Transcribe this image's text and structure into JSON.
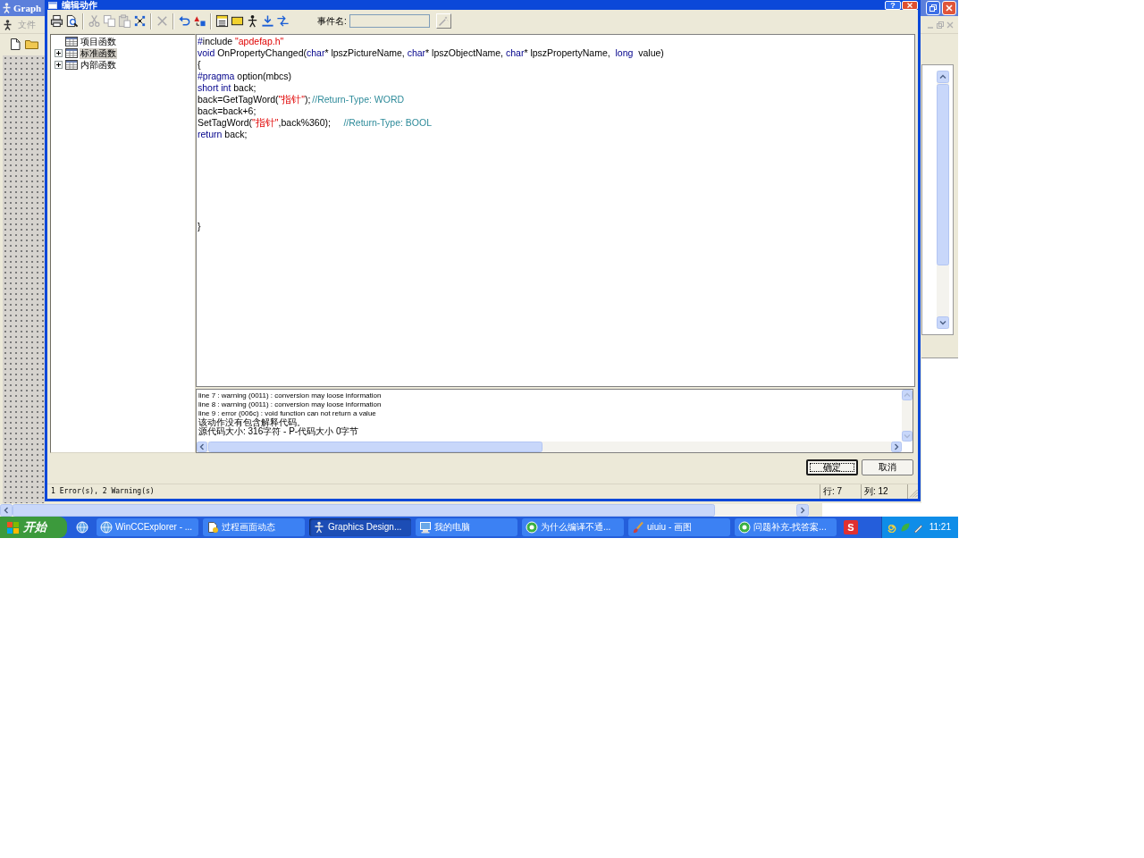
{
  "background_window": {
    "title": "Graph",
    "menu": [
      "文件"
    ]
  },
  "dialog": {
    "title": "编辑动作",
    "help_button": "?",
    "toolbar": {
      "groups": [
        [
          {
            "disabled": false
          },
          {
            "disabled": false
          }
        ],
        [
          {
            "disabled": true
          },
          {
            "disabled": true
          },
          {
            "disabled": true
          },
          {
            "disabled": false
          }
        ],
        [
          {
            "disabled": true
          }
        ],
        [
          {
            "disabled": false
          },
          {
            "disabled": false
          }
        ],
        [
          {
            "disabled": false
          },
          {
            "disabled": false
          },
          {
            "disabled": false
          },
          {
            "disabled": false
          },
          {
            "disabled": false
          }
        ]
      ]
    },
    "event_name": {
      "label": "事件名:",
      "disabled": true
    },
    "event_button": {
      "disabled": true
    },
    "tree": [
      {
        "label": "项目函数",
        "expandable": false,
        "selected": false
      },
      {
        "label": "标准函数",
        "expandable": true,
        "expanded": false,
        "selected": true
      },
      {
        "label": "内部函数",
        "expandable": true,
        "expanded": false,
        "selected": false
      }
    ],
    "editor": {
      "lines": [
        {
          "segments": [
            {
              "kind": "keyword",
              "text": "#"
            },
            {
              "kind": "plain",
              "text": "include "
            },
            {
              "kind": "string",
              "text": "\"apdefap.h\""
            }
          ]
        },
        {
          "segments": [
            {
              "kind": "keyword",
              "text": "void"
            },
            {
              "kind": "plain",
              "text": " OnPropertyChanged("
            },
            {
              "kind": "keyword",
              "text": "char"
            },
            {
              "kind": "plain",
              "text": "* lpszPictureName, "
            },
            {
              "kind": "keyword",
              "text": "char"
            },
            {
              "kind": "plain",
              "text": "* lpszObjectName, "
            },
            {
              "kind": "keyword",
              "text": "char"
            },
            {
              "kind": "plain",
              "text": "* lpszPropertyName,  "
            },
            {
              "kind": "keyword",
              "text": "long"
            },
            {
              "kind": "plain",
              "text": "  value)"
            }
          ]
        },
        {
          "segments": [
            {
              "kind": "plain",
              "text": "{"
            }
          ]
        },
        {
          "segments": [
            {
              "kind": "keyword",
              "text": "#pragma"
            },
            {
              "kind": "plain",
              "text": " option(mbcs)"
            }
          ]
        },
        {
          "segments": [
            {
              "kind": "keyword",
              "text": "short int"
            },
            {
              "kind": "plain",
              "text": " back;"
            }
          ]
        },
        {
          "segments": [
            {
              "kind": "plain",
              "text": "back=GetTagWord("
            },
            {
              "kind": "string",
              "text": "\"指针\""
            },
            {
              "kind": "plain",
              "text": ");\t"
            },
            {
              "kind": "comment",
              "text": "//Return-Type: WORD"
            }
          ]
        },
        {
          "segments": [
            {
              "kind": "plain",
              "text": "back=back+6;"
            }
          ]
        },
        {
          "segments": [
            {
              "kind": "plain",
              "text": "SetTagWord("
            },
            {
              "kind": "string",
              "text": "\"指针\""
            },
            {
              "kind": "plain",
              "text": ",back%360);\t\t"
            },
            {
              "kind": "comment",
              "text": "//Return-Type: BOOL"
            }
          ]
        },
        {
          "segments": [
            {
              "kind": "keyword",
              "text": "return"
            },
            {
              "kind": "plain",
              "text": " back;"
            }
          ]
        }
      ],
      "closing_line": "}"
    },
    "output": {
      "lines": [
        {
          "kind": "diagnostic",
          "text": "line 7 : warning (0011) : conversion may loose information"
        },
        {
          "kind": "diagnostic",
          "text": "line 8 : warning (0011) : conversion may loose information"
        },
        {
          "kind": "diagnostic",
          "text": "line 9 : error (006c) : void function can not return a value"
        },
        {
          "kind": "summary",
          "text": "该动作没有包含解释代码。"
        },
        {
          "kind": "summary",
          "text": "源代码大小: 316字符 - P-代码大小 0字节"
        }
      ]
    },
    "buttons": [
      {
        "label": "确定",
        "focused": true
      },
      {
        "label": "取消",
        "focused": false
      }
    ],
    "status_bar": {
      "message": "1 Error(s), 2 Warning(s)",
      "row": "行: 7",
      "column": "列: 12"
    }
  },
  "taskbar": {
    "start": "开始",
    "tasks": [
      {
        "label": "WinCCExplorer - ...",
        "selected": false
      },
      {
        "label": "过程画面动态",
        "selected": false
      },
      {
        "label": "Graphics Design...",
        "selected": true
      },
      {
        "label": "我的电脑",
        "selected": false
      },
      {
        "label": "为什么编译不通...",
        "selected": false
      },
      {
        "label": "uiuiu - 画图",
        "selected": false
      },
      {
        "label": "问题补充-找答案...",
        "selected": false
      }
    ],
    "extra_button": "S",
    "clock": "11:21"
  }
}
